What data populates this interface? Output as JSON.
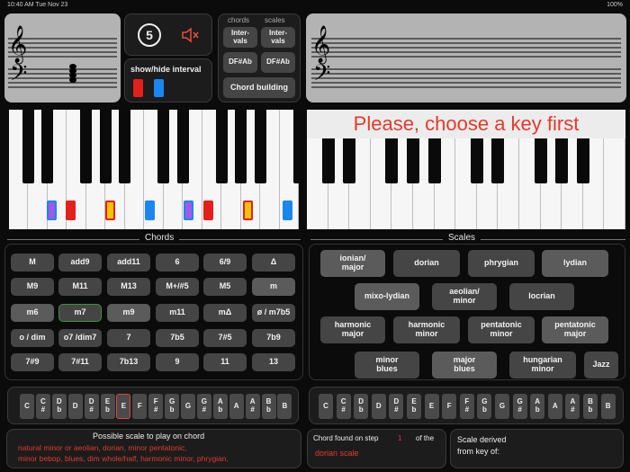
{
  "status_bar": {
    "time": "10:40 AM  Tue Nov 23",
    "battery": "100%"
  },
  "left_staff": {
    "clef_treble": "𝄞",
    "clef_bass": "𝄢"
  },
  "right_staff": {
    "clef_treble": "𝄞",
    "clef_bass": "𝄢"
  },
  "controls": {
    "count": "5",
    "show_hide_label": "show/hide interval",
    "colors": {
      "marker_red": "#e3201b",
      "marker_blue": "#1a86f0",
      "marker_purple": "#a05ae8",
      "marker_yellow": "#f2c400",
      "accent_red": "#e23b2e"
    }
  },
  "mode": {
    "chords_header": "chords",
    "scales_header": "scales",
    "chords_intervals": "Inter-\nvals",
    "scales_intervals": "Inter-\nvals",
    "chords_spelling": "DF#Ab",
    "scales_spelling": "DF#Ab",
    "chord_building": "Chord building"
  },
  "right_keyboard": {
    "prompt": "Please, choose a key first"
  },
  "chords": {
    "title": "Chords",
    "rows": [
      [
        "M",
        "add9",
        "add11",
        "6",
        "6/9",
        "Δ"
      ],
      [
        "M9",
        "M11",
        "M13",
        "M+/#5",
        "M5",
        "m"
      ],
      [
        "m6",
        "m7",
        "m9",
        "m11",
        "mΔ",
        "ø / m7b5"
      ],
      [
        "o / dim",
        "o7 /dim7",
        "7",
        "7b5",
        "7#5",
        "7b9"
      ],
      [
        "7#9",
        "7#11",
        "7b13",
        "9",
        "11",
        "13"
      ]
    ]
  },
  "scales": {
    "title": "Scales",
    "items": [
      "ionian/\nmajor",
      "dorian",
      "phrygian",
      "lydian",
      "mixo-lydian",
      "aeolian/\nminor",
      "locrian",
      "harmonic\nmajor",
      "harmonic\nminor",
      "pentatonic\nminor",
      "pentatonic\nmajor",
      "minor\nblues",
      "major\nblues",
      "hungarian\nminor",
      "Jazz"
    ]
  },
  "note_keys": [
    [
      "C",
      ""
    ],
    [
      "C",
      "#"
    ],
    [
      "D",
      "b"
    ],
    [
      "D",
      ""
    ],
    [
      "D",
      "#"
    ],
    [
      "E",
      "b"
    ],
    [
      "E",
      ""
    ],
    [
      "F",
      ""
    ],
    [
      "F",
      "#"
    ],
    [
      "G",
      "b"
    ],
    [
      "G",
      ""
    ],
    [
      "G",
      "#"
    ],
    [
      "A",
      "b"
    ],
    [
      "A",
      ""
    ],
    [
      "A",
      "#"
    ],
    [
      "B",
      "b"
    ],
    [
      "B",
      ""
    ]
  ],
  "bottom": {
    "possible_title": "Possible scale to play on chord",
    "possible_text": "natural minor or aeolian, dorian, minor pentatonic,\nminor bebop, blues, dim whole/half, harmonic minor, phrygian,",
    "chord_found_label": "Chord found on step",
    "chord_found_step": "1",
    "chord_found_of": "of the",
    "chord_found_scale": "dorian scale",
    "scale_derived": "Scale derived\nfrom key of:"
  }
}
